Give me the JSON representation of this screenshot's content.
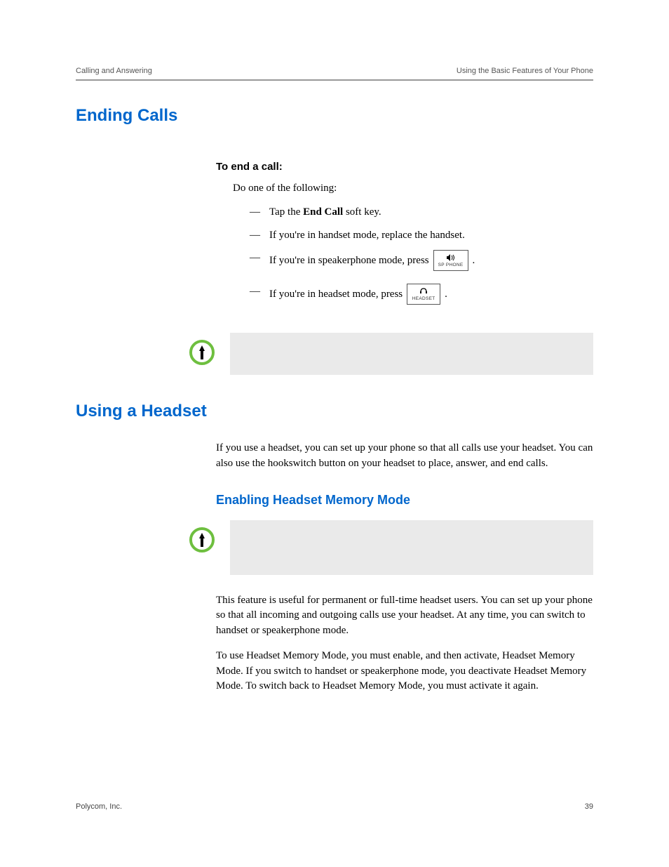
{
  "header": {
    "left": "Calling and Answering",
    "right": "Using the Basic Features of Your Phone"
  },
  "sections": {
    "ending_calls": {
      "title": "Ending Calls",
      "proc_head": "To end a call:",
      "lead": "Do one of the following:",
      "items": {
        "i0_pre": "Tap the ",
        "i0_bold": "End Call",
        "i0_post": " soft key.",
        "i1": "If you're in handset mode, replace the handset.",
        "i2_pre": "If you're in speakerphone mode, press ",
        "i2_post": ".",
        "i3_pre": "If you're in headset mode, press ",
        "i3_post": "."
      },
      "keys": {
        "sp_label": "SP PHONE",
        "headset_label": "HEADSET"
      }
    },
    "using_headset": {
      "title": "Using a Headset",
      "intro": "If you use a headset, you can set up your phone so that all calls use your headset. You can also use the hookswitch button on your headset to place, answer, and end calls.",
      "subhead": "Enabling Headset Memory Mode",
      "p1": "This feature is useful for permanent or full-time headset users. You can set up your phone so that all incoming and outgoing calls use your headset. At any time, you can switch to handset or speakerphone mode.",
      "p2": "To use Headset Memory Mode, you must enable, and then activate, Headset Memory Mode. If you switch to handset or speakerphone mode, you deactivate Headset Memory Mode. To switch back to Headset Memory Mode, you must activate it again."
    }
  },
  "footer": {
    "left": "Polycom, Inc.",
    "right": "39"
  }
}
